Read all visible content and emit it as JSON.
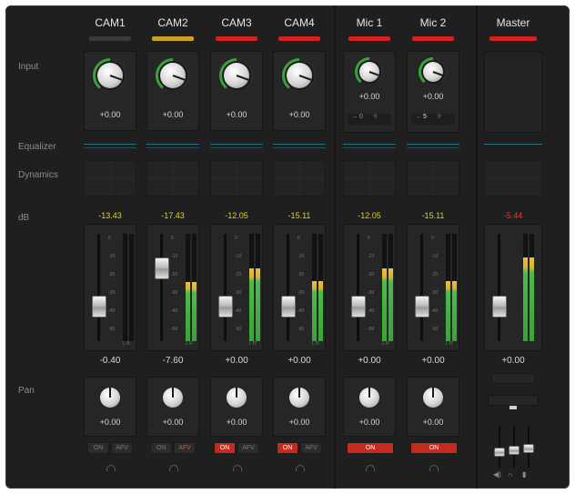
{
  "row_labels": {
    "input": "Input",
    "equalizer": "Equalizer",
    "dynamics": "Dynamics",
    "db": "dB",
    "pan": "Pan"
  },
  "colors": {
    "grey": "#3a3a3a",
    "amber": "#c9a227",
    "red": "#d32020",
    "peak_yellow": "#d8d23a",
    "peak_red": "#e23d2d"
  },
  "channels": [
    {
      "name": "CAM1",
      "bar": "grey",
      "input": "+0.00",
      "peak": "-13.43",
      "level": "-0.40",
      "pan": "+0.00",
      "buttons": [
        {
          "label": "ON",
          "state": "off"
        },
        {
          "label": "AFV",
          "state": "off"
        }
      ],
      "meter": [
        0.0,
        0.0
      ],
      "fader": 0.3
    },
    {
      "name": "CAM2",
      "bar": "amber",
      "input": "+0.00",
      "peak": "-17.43",
      "level": "-7.60",
      "pan": "+0.00",
      "buttons": [
        {
          "label": "ON",
          "state": "off"
        },
        {
          "label": "AFV",
          "state": "afv"
        }
      ],
      "meter": [
        0.55,
        0.55
      ],
      "fader": 0.72
    },
    {
      "name": "CAM3",
      "bar": "red",
      "input": "+0.00",
      "peak": "-12.05",
      "level": "+0.00",
      "pan": "+0.00",
      "buttons": [
        {
          "label": "ON",
          "state": "on"
        },
        {
          "label": "AFV",
          "state": "off"
        }
      ],
      "meter": [
        0.68,
        0.68
      ],
      "fader": 0.3
    },
    {
      "name": "CAM4",
      "bar": "red",
      "input": "+0.00",
      "peak": "-15.11",
      "level": "+0.00",
      "pan": "+0.00",
      "buttons": [
        {
          "label": "ON",
          "state": "on"
        },
        {
          "label": "AFV",
          "state": "off"
        }
      ],
      "meter": [
        0.56,
        0.56
      ],
      "fader": 0.3
    },
    {
      "name": "Mic 1",
      "bar": "red",
      "input": "+0.00",
      "peak": "-12.05",
      "level": "+0.00",
      "pan": "+0.00",
      "delay": {
        "value": "0",
        "unit": "fr"
      },
      "buttons": [
        {
          "label": "ON",
          "state": "on"
        }
      ],
      "meter": [
        0.68,
        0.68
      ],
      "fader": 0.3
    },
    {
      "name": "Mic 2",
      "bar": "red",
      "input": "+0.00",
      "peak": "-15.11",
      "level": "+0.00",
      "pan": "+0.00",
      "delay": {
        "value": "5",
        "unit": "fr"
      },
      "buttons": [
        {
          "label": "ON",
          "state": "on"
        }
      ],
      "meter": [
        0.56,
        0.56
      ],
      "fader": 0.3
    }
  ],
  "master": {
    "name": "Master",
    "bar": "red",
    "peak": "-5.44",
    "level": "+0.00",
    "meter": [
      0.78,
      0.78
    ],
    "fader": 0.3,
    "controls": [
      "speaker-icon",
      "headphones-icon",
      "microphone-icon"
    ]
  }
}
